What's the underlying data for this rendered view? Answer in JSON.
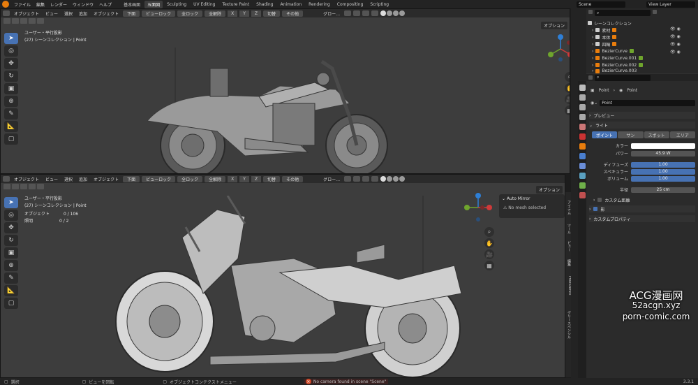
{
  "topbar": {
    "menus": [
      "ファイル",
      "編集",
      "レンダー",
      "ウィンドウ",
      "ヘルプ"
    ],
    "workspaces": [
      "基本画面",
      "五面図",
      "Sculpting",
      "UV Editing",
      "Texture Paint",
      "Shading",
      "Animation",
      "Rendering",
      "Compositing",
      "Scripting"
    ],
    "active_workspace": "五面図",
    "scene": "Scene",
    "view_layer": "View Layer"
  },
  "viewport_header": {
    "mode": "オブジェクト",
    "view": "ビュー",
    "select": "選択",
    "add": "追加",
    "object": "オブジェクト",
    "bottom": "下面",
    "view_lock": "ビューロック",
    "global": "全ロック",
    "all_release": "全解除",
    "x": "X",
    "y": "Y",
    "z": "Z",
    "cut": "切替",
    "other": "その他",
    "shading": "グロー…",
    "options": "オプション"
  },
  "viewport_top": {
    "line1": "ユーザー・平行投影",
    "line2": "(27) シーンコレクション | Point"
  },
  "viewport_bottom": {
    "line1": "ユーザー・平行投影",
    "line2": "(27) シーンコレクション | Point",
    "objects_label": "オブジェクト",
    "objects_value": "0 / 106",
    "lights_label": "照明",
    "lights_value": "0 / 2",
    "auto_mirror_title": "Auto Mirror",
    "auto_mirror_msg": "No mesh selected"
  },
  "sidebar_tabs": [
    "アイテム",
    "ツール",
    "ビュー",
    "編集",
    "FreeStencil",
    "グリースペンシル"
  ],
  "outliner": {
    "title": "シーンコレクション",
    "rows": [
      "素材",
      "本体",
      "四輪",
      "BezierCurve",
      "BezierCurve.001",
      "BezierCurve.002",
      "BezierCurve.003"
    ]
  },
  "properties": {
    "breadcrumb_a": "Point",
    "breadcrumb_b": "Point",
    "data_name": "Point",
    "preview": "プレビュー",
    "light": "ライト",
    "types": [
      "ポイント",
      "サン",
      "スポット",
      "エリア"
    ],
    "color_label": "カラー",
    "power_label": "パワー",
    "power_value": "45.9 W",
    "diffuse_label": "ディフューズ",
    "diffuse_value": "1.00",
    "specular_label": "スペキュラー",
    "specular_value": "1.00",
    "volume_label": "ボリューム",
    "volume_value": "1.00",
    "radius_label": "半径",
    "radius_value": "25 cm",
    "custom_dist": "カスタム距離",
    "shadow": "影",
    "custom_props": "カスタムプロパティ"
  },
  "status": {
    "select": "選択",
    "rotate": "ビューを回転",
    "ctx": "オブジェクトコンテクストメニュー",
    "warning": "No camera found in scene \"Scene\"",
    "version": "3.3.1"
  },
  "watermark": {
    "line1": "ACG漫画网",
    "line2": "52acgn.xyz",
    "line3": "porn-comic.com"
  },
  "colors": {
    "accent": "#4772b3",
    "warning": "#d04a2a",
    "orange": "#e87d0d"
  }
}
